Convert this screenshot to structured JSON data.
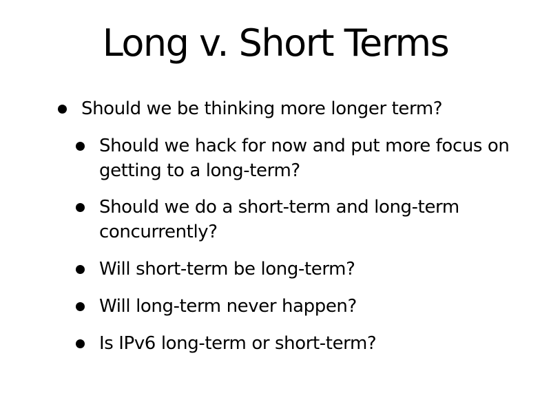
{
  "slide": {
    "title": "Long v. Short Terms",
    "bullets": [
      {
        "text": "Should we be thinking more longer term?",
        "sub_bullets": [
          {
            "text": "Should we hack for now and put more focus on getting to a long-term?"
          },
          {
            "text": "Should we do a short-term and long-term concurrently?"
          },
          {
            "text": "Will short-term be long-term?"
          },
          {
            "text": "Will long-term never happen?"
          },
          {
            "text": "Is IPv6 long-term or short-term?"
          }
        ]
      }
    ]
  },
  "colors": {
    "background": "#ffffff",
    "text": "#000000"
  }
}
